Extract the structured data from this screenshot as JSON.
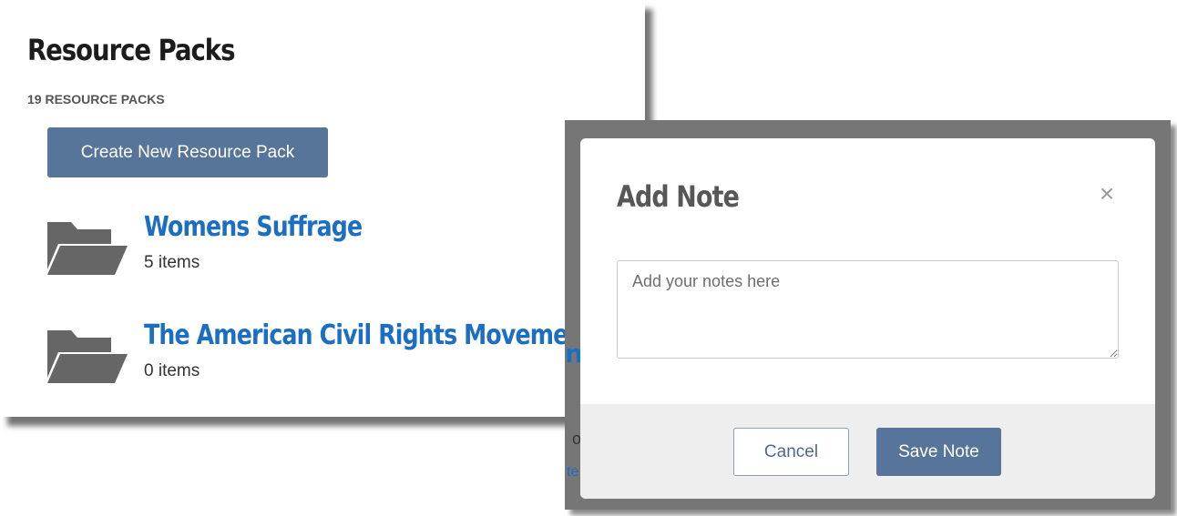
{
  "resource_packs": {
    "title": "Resource Packs",
    "count_label": "19 RESOURCE PACKS",
    "create_button_label": "Create New Resource Pack",
    "items": [
      {
        "name": "Womens Suffrage",
        "meta": "5 items",
        "icon": "folder-icon"
      },
      {
        "name": "The American Civil Rights Moveme",
        "meta": "0 items",
        "icon": "folder-icon"
      }
    ]
  },
  "background_fragments": [
    "n's",
    "o",
    "te"
  ],
  "modal": {
    "title": "Add Note",
    "close_glyph": "×",
    "close_icon": "close-icon",
    "textarea": {
      "placeholder": "Add your notes here",
      "value": ""
    },
    "cancel_label": "Cancel",
    "save_label": "Save Note"
  },
  "colors": {
    "primary_button": "#57749a",
    "link_blue": "#1b6ec2",
    "overlay": "#767676",
    "footer_bg": "#eeeeee"
  }
}
